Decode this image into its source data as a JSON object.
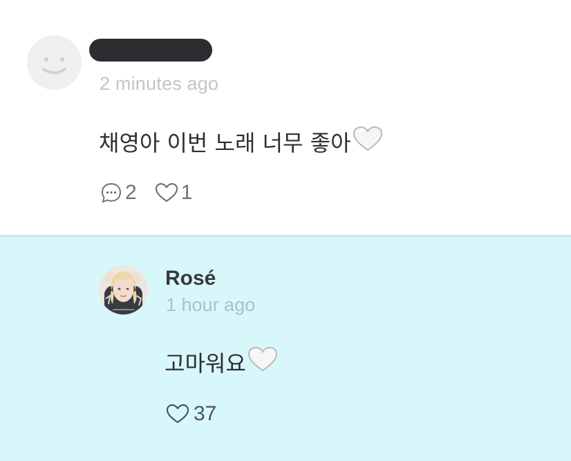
{
  "comment": {
    "avatar": "smiley-face-icon",
    "time": "2 minutes ago",
    "text": "채영아 이번 노래 너무 좋아",
    "emoji": "white-heart-icon",
    "reply_count": "2",
    "like_count": "1"
  },
  "reply": {
    "author": "Rosé",
    "avatar": "user-avatar-photo",
    "time": "1 hour ago",
    "text": "고마워요",
    "emoji": "white-heart-icon",
    "like_count": "37"
  },
  "colors": {
    "reply_background": "#d8f7fb",
    "redaction": "#2b2d31"
  }
}
